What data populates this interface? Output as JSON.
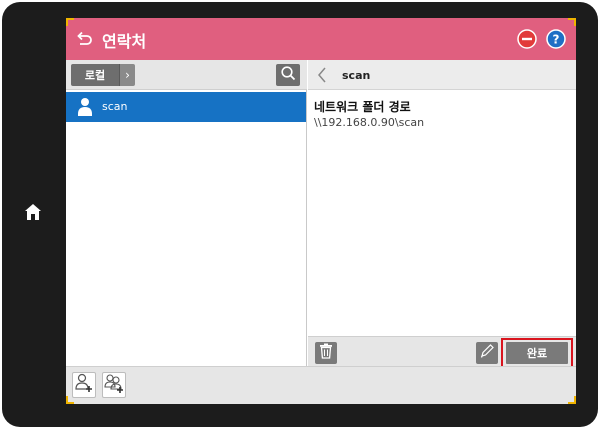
{
  "header": {
    "title": "연락처",
    "brand_color": "#e05f7f"
  },
  "left_pane": {
    "source_button_label": "로컬",
    "source_arrow": "›",
    "contacts": [
      {
        "name": "scan",
        "selected": true
      }
    ]
  },
  "right_pane": {
    "back_arrow": "‹",
    "contact_title": "scan",
    "field_label": "네트워크 폴더 경로",
    "field_value": "\\\\192.168.0.90\\scan",
    "done_label": "완료"
  },
  "icons": {
    "back": "back-icon",
    "cancel": "cancel-icon",
    "help": "help-icon",
    "search": "search-icon",
    "contact": "person-icon",
    "trash": "trash-icon",
    "edit": "pencil-icon",
    "add_contact": "add-contact-icon",
    "add_group": "add-group-icon",
    "home": "home-icon"
  },
  "colors": {
    "selected_row": "#1672c4",
    "highlight_outline": "#d9141e",
    "cancel_red": "#e23b3b",
    "help_blue": "#1f6fc5"
  }
}
